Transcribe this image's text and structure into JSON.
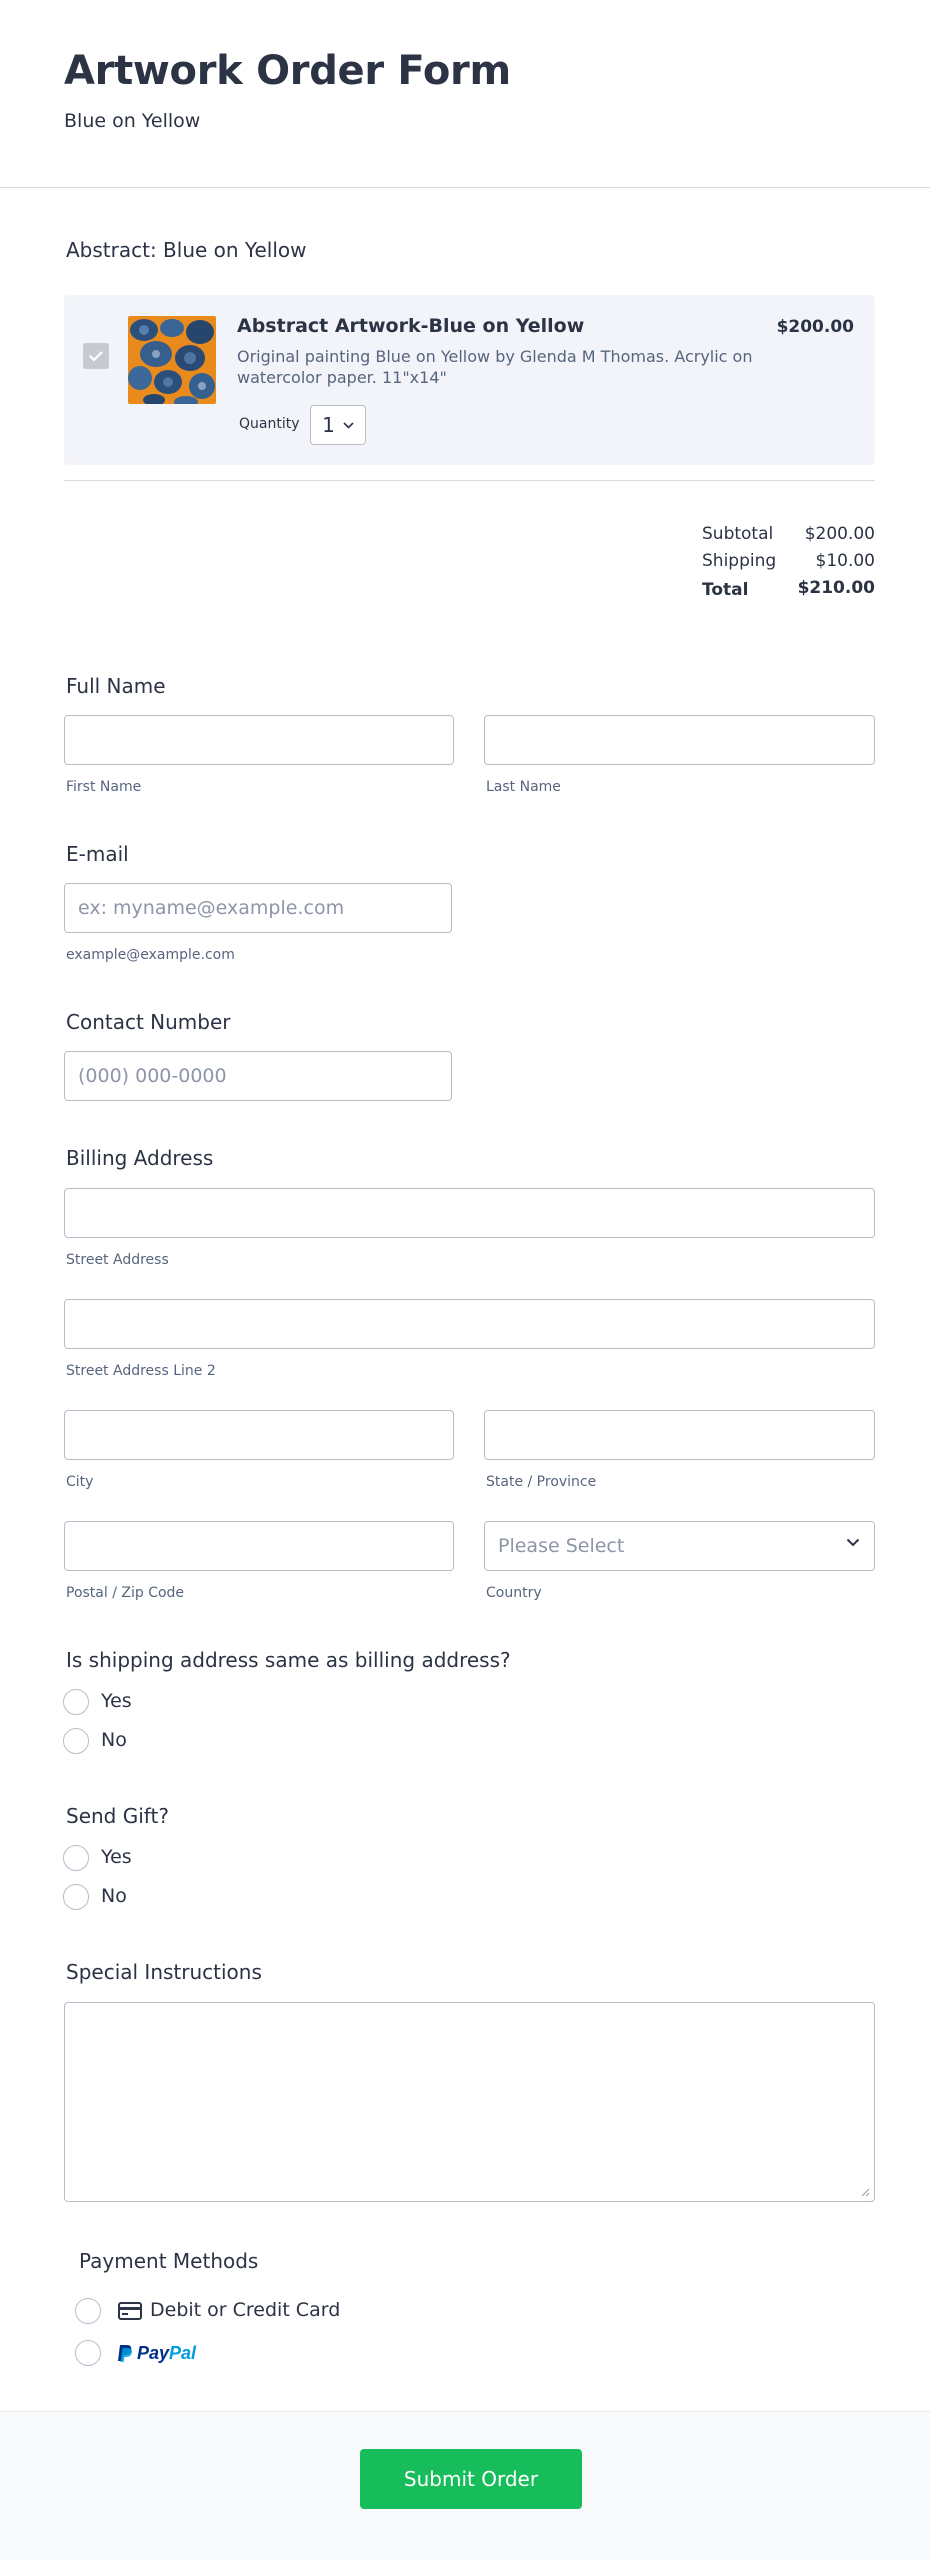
{
  "form": {
    "title": "Artwork Order Form",
    "subtitle": "Blue on Yellow"
  },
  "product_section": {
    "heading": "Abstract: Blue on Yellow",
    "product": {
      "name": "Abstract Artwork-Blue on Yellow",
      "price": "$200.00",
      "description": "Original painting Blue on Yellow by Glenda M Thomas. Acrylic on watercolor paper. 11\"x14\"",
      "quantity_label": "Quantity",
      "quantity_value": "1",
      "selected": true
    },
    "totals": {
      "subtotal_label": "Subtotal",
      "subtotal_value": "$200.00",
      "shipping_label": "Shipping",
      "shipping_value": "$10.00",
      "total_label": "Total",
      "total_value": "$210.00"
    }
  },
  "full_name": {
    "label": "Full Name",
    "first_sublabel": "First Name",
    "last_sublabel": "Last Name"
  },
  "email": {
    "label": "E-mail",
    "placeholder": "ex: myname@example.com",
    "sublabel": "example@example.com"
  },
  "contact": {
    "label": "Contact Number",
    "placeholder": "(000) 000-0000"
  },
  "billing": {
    "label": "Billing Address",
    "street_sublabel": "Street Address",
    "street2_sublabel": "Street Address Line 2",
    "city_sublabel": "City",
    "state_sublabel": "State / Province",
    "zip_sublabel": "Postal / Zip Code",
    "country_sublabel": "Country",
    "country_placeholder": "Please Select"
  },
  "shipping_same": {
    "question": "Is shipping address same as billing address?",
    "options": [
      "Yes",
      "No"
    ]
  },
  "send_gift": {
    "question": "Send Gift?",
    "options": [
      "Yes",
      "No"
    ]
  },
  "special_instructions": {
    "label": "Special Instructions"
  },
  "payment": {
    "label": "Payment Methods",
    "card_label": "Debit or Credit Card",
    "paypal_label": "PayPal"
  },
  "submit_label": "Submit Order",
  "colors": {
    "accent_green": "#18bd5b",
    "text_dark": "#2c3345",
    "paypal_dark": "#003087",
    "paypal_light": "#009cde",
    "card_bg": "#f3f4f9"
  }
}
